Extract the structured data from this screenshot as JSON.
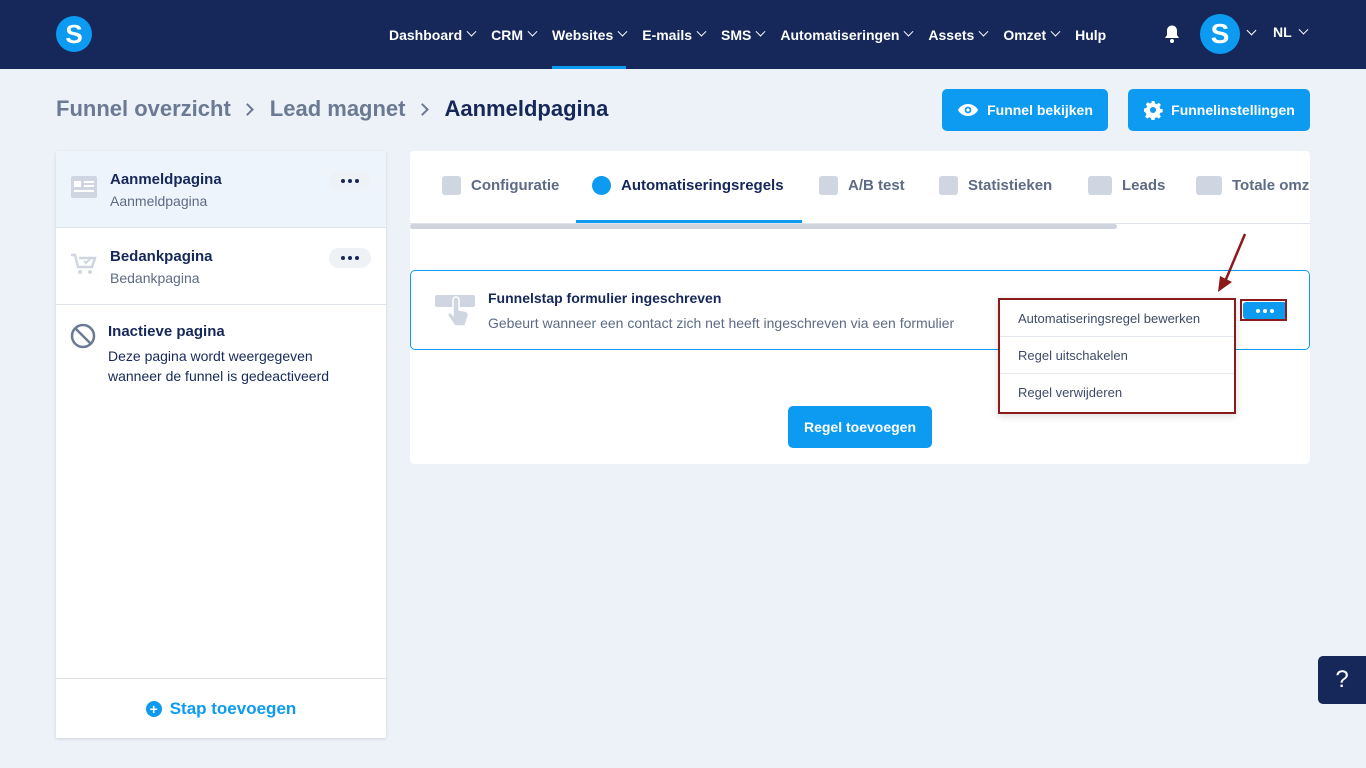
{
  "nav": {
    "items": [
      {
        "label": "Dashboard",
        "has_chevron": true
      },
      {
        "label": "CRM",
        "has_chevron": true
      },
      {
        "label": "Websites",
        "has_chevron": true,
        "active": true
      },
      {
        "label": "E-mails",
        "has_chevron": true
      },
      {
        "label": "SMS",
        "has_chevron": true
      },
      {
        "label": "Automatiseringen",
        "has_chevron": true
      },
      {
        "label": "Assets",
        "has_chevron": true
      },
      {
        "label": "Omzet",
        "has_chevron": true
      },
      {
        "label": "Hulp",
        "has_chevron": false
      }
    ],
    "logo_letter": "S",
    "avatar_letter": "S",
    "language": "NL"
  },
  "breadcrumb": {
    "items": [
      "Funnel overzicht",
      "Lead magnet",
      "Aanmeldpagina"
    ]
  },
  "header_buttons": {
    "view_funnel": "Funnel bekijken",
    "funnel_settings": "Funnelinstellingen"
  },
  "sidebar": {
    "steps": [
      {
        "title": "Aanmeldpagina",
        "subtitle": "Aanmeldpagina",
        "icon": "form-page-icon",
        "selected": true
      },
      {
        "title": "Bedankpagina",
        "subtitle": "Bedankpagina",
        "icon": "cart-check-icon",
        "selected": false
      }
    ],
    "inactive": {
      "title": "Inactieve pagina",
      "description": "Deze pagina wordt weergegeven wanneer de funnel is gedeactiveerd"
    },
    "add_step_label": "Stap toevoegen"
  },
  "tabs": [
    {
      "label": "Configuratie",
      "icon": "sliders-icon"
    },
    {
      "label": "Automatiseringsregels",
      "icon": "bolt-icon",
      "active": true
    },
    {
      "label": "A/B test",
      "icon": "split-icon"
    },
    {
      "label": "Statistieken",
      "icon": "bar-chart-icon"
    },
    {
      "label": "Leads",
      "icon": "users-icon"
    },
    {
      "label": "Totale omz",
      "icon": "dollar-icon"
    }
  ],
  "rule": {
    "title": "Funnelstap formulier ingeschreven",
    "description": "Gebeurt wanneer een contact zich net heeft ingeschreven via een formulier"
  },
  "add_rule_label": "Regel toevoegen",
  "dropdown": {
    "items": [
      "Automatiseringsregel bewerken",
      "Regel uitschakelen",
      "Regel verwijderen"
    ]
  },
  "help_label": "?",
  "colors": {
    "nav_bg": "#16285a",
    "accent": "#0d9bf2",
    "annotation": "#8b1a1a",
    "page_bg": "#edf1f8"
  }
}
